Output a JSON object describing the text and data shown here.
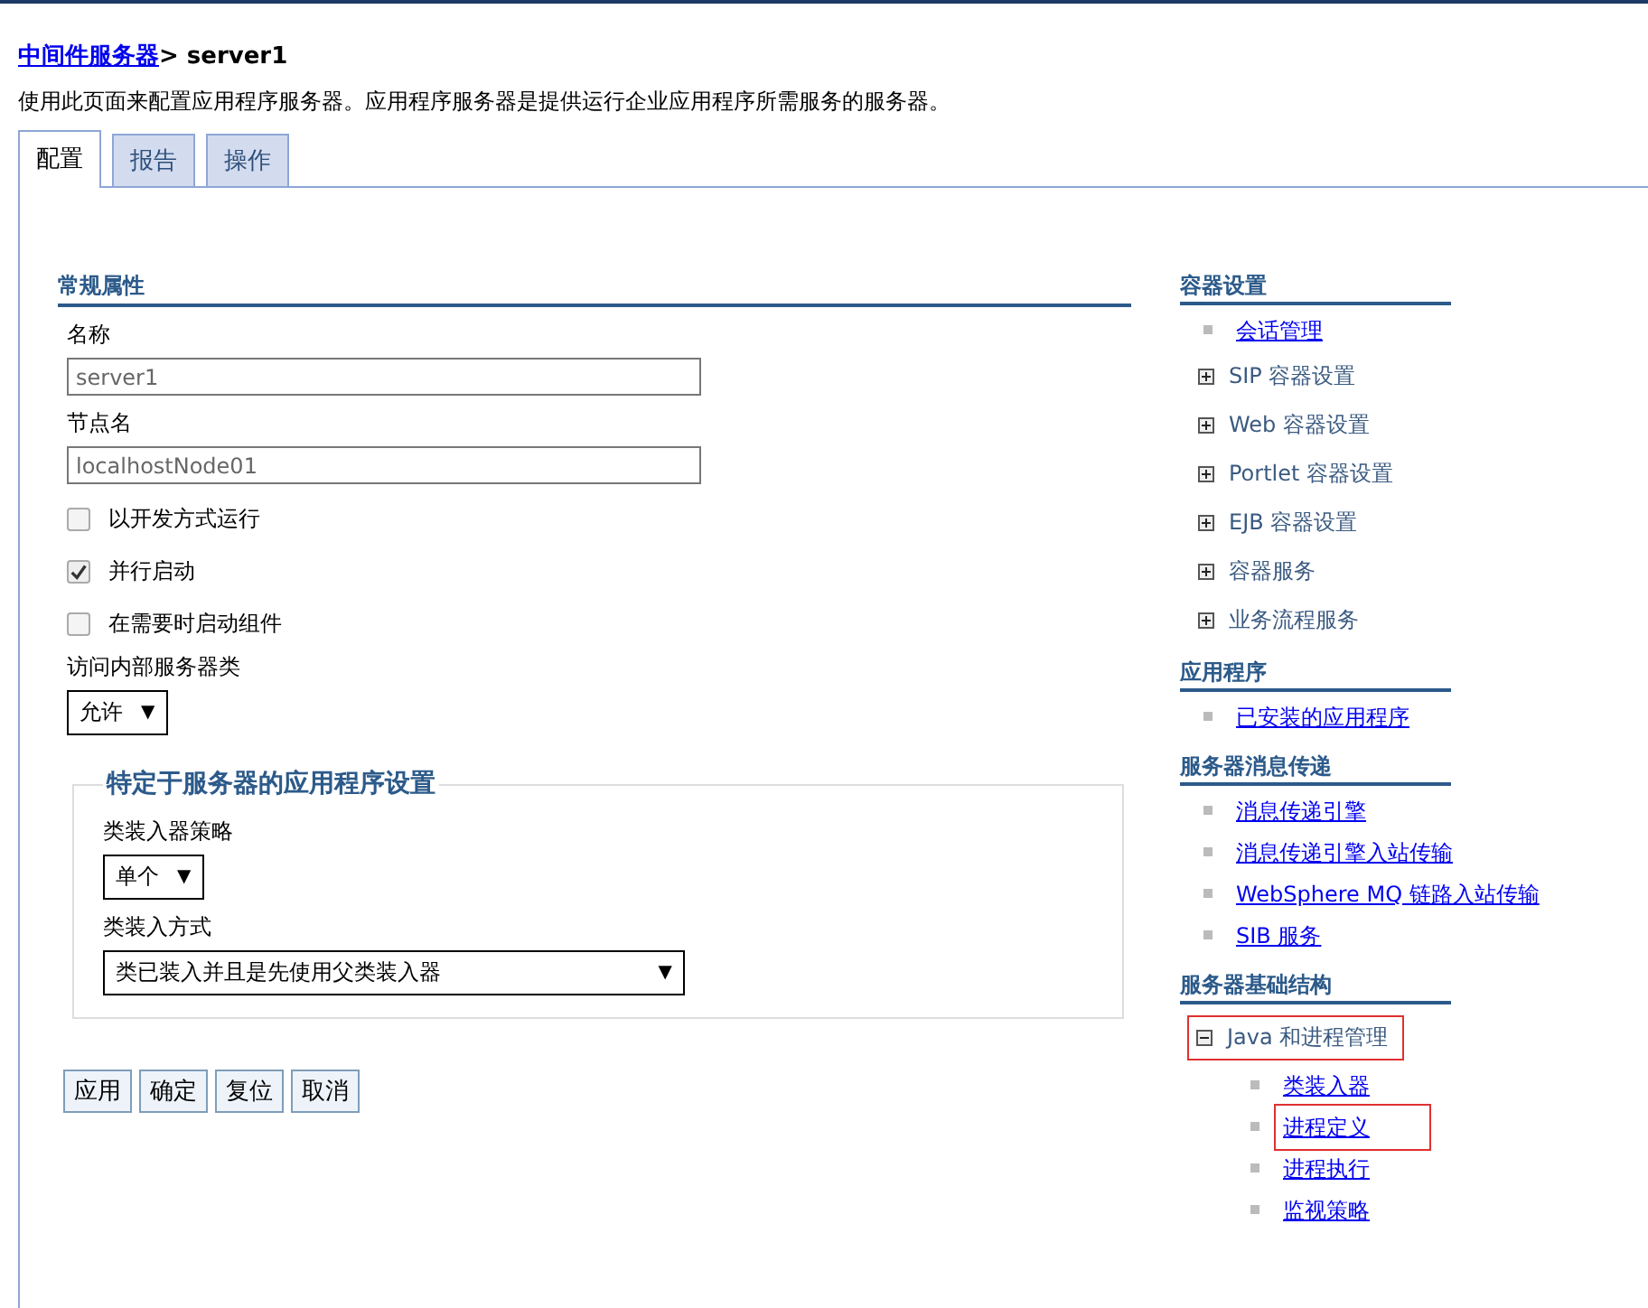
{
  "breadcrumb": {
    "link": "中间件服务器",
    "separator": ">",
    "current": "server1"
  },
  "description": "使用此页面来配置应用程序服务器。应用程序服务器是提供运行企业应用程序所需服务的服务器。",
  "tabs": [
    {
      "label": "配置",
      "selected": true
    },
    {
      "label": "报告",
      "selected": false
    },
    {
      "label": "操作",
      "selected": false
    }
  ],
  "general": {
    "title": "常规属性",
    "fields": [
      {
        "label": "名称",
        "value": "server1"
      },
      {
        "label": "节点名",
        "value": "localhostNode01"
      }
    ],
    "checkboxes": [
      {
        "label": "以开发方式运行",
        "checked": false
      },
      {
        "label": "并行启动",
        "checked": true
      },
      {
        "label": "在需要时启动组件",
        "checked": false
      }
    ],
    "select": {
      "label": "访问内部服务器类",
      "value": "允许",
      "arrow": "▼"
    }
  },
  "app_settings": {
    "title": "特定于服务器的应用程序设置",
    "selects": [
      {
        "label": "类装入器策略",
        "value": "单个",
        "arrow": "▼",
        "wide": false
      },
      {
        "label": "类装入方式",
        "value": "类已装入并且是先使用父类装入器",
        "arrow": "▼",
        "wide": true
      }
    ]
  },
  "buttons": [
    "应用",
    "确定",
    "复位",
    "取消"
  ],
  "sidebar": [
    {
      "title": "容器设置",
      "items": [
        {
          "kind": "link",
          "label": "会话管理",
          "highlighted": false
        },
        {
          "kind": "expander",
          "label": "SIP 容器设置",
          "expanded": false,
          "highlighted": false
        },
        {
          "kind": "expander",
          "label": "Web 容器设置",
          "expanded": false,
          "highlighted": false
        },
        {
          "kind": "expander",
          "label": "Portlet 容器设置",
          "expanded": false,
          "highlighted": false
        },
        {
          "kind": "expander",
          "label": "EJB 容器设置",
          "expanded": false,
          "highlighted": false
        },
        {
          "kind": "expander",
          "label": "容器服务",
          "expanded": false,
          "highlighted": false
        },
        {
          "kind": "expander",
          "label": "业务流程服务",
          "expanded": false,
          "highlighted": false
        }
      ]
    },
    {
      "title": "应用程序",
      "items": [
        {
          "kind": "link",
          "label": "已安装的应用程序",
          "highlighted": false
        }
      ]
    },
    {
      "title": "服务器消息传递",
      "items": [
        {
          "kind": "link",
          "label": "消息传递引擎",
          "highlighted": false
        },
        {
          "kind": "link",
          "label": "消息传递引擎入站传输",
          "highlighted": false
        },
        {
          "kind": "link",
          "label": "WebSphere MQ 链路入站传输",
          "highlighted": false
        },
        {
          "kind": "link",
          "label": "SIB 服务",
          "highlighted": false
        }
      ]
    },
    {
      "title": "服务器基础结构",
      "items": [
        {
          "kind": "expander",
          "label": "Java 和进程管理",
          "expanded": true,
          "highlighted": true,
          "children": [
            {
              "label": "类装入器",
              "highlighted": false
            },
            {
              "label": "进程定义",
              "highlighted": true
            },
            {
              "label": "进程执行",
              "highlighted": false
            },
            {
              "label": "监视策略",
              "highlighted": false
            }
          ]
        }
      ]
    }
  ]
}
